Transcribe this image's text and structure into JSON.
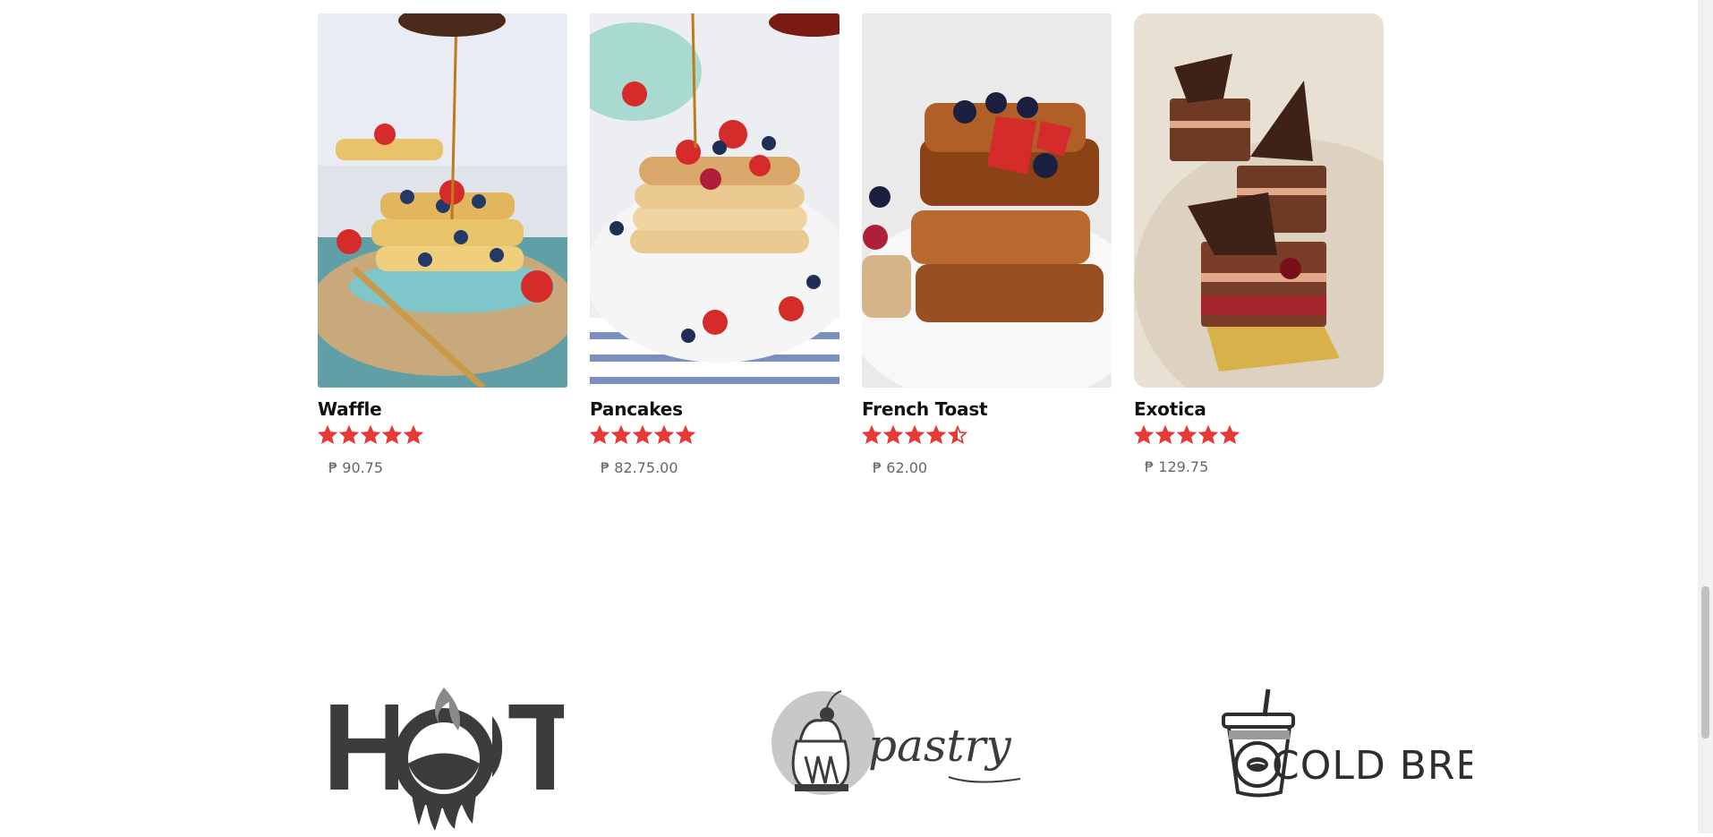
{
  "products": [
    {
      "name": "Waffle",
      "rating": 5,
      "price": "₱ 90.75",
      "photo_icon": "waffle-photo"
    },
    {
      "name": "Pancakes",
      "rating": 5,
      "price": "₱ 82.75.00",
      "photo_icon": "pancakes-photo"
    },
    {
      "name": "French Toast",
      "rating": 4.5,
      "price": "₱ 62.00",
      "photo_icon": "french-toast-photo"
    },
    {
      "name": "Exotica",
      "rating": 5,
      "price": "₱ 129.75",
      "photo_icon": "exotica-photo"
    }
  ],
  "categories": [
    {
      "label": "HOT",
      "icon": "hot-logo"
    },
    {
      "label": "pastry",
      "icon": "pastry-logo"
    },
    {
      "label": "COLD BREW",
      "icon": "cold-brew-logo"
    }
  ],
  "colors": {
    "star": "#e53935",
    "logo": "#3c3c3c",
    "price": "#666666"
  }
}
